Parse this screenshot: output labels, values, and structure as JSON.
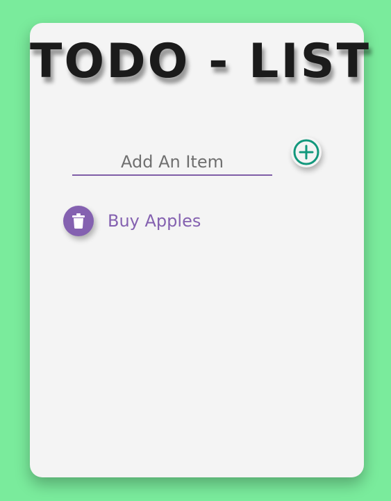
{
  "app": {
    "title": "TODO - LIST"
  },
  "input": {
    "placeholder": "Add An Item",
    "value": ""
  },
  "add_button": {
    "icon": "plus-circle-icon"
  },
  "items": [
    {
      "label": "Buy Apples",
      "icon": "trash-icon"
    }
  ],
  "colors": {
    "background": "#7aeb9c",
    "card": "#f4f4f4",
    "accent_purple": "#8461b0",
    "accent_teal": "#12977c"
  }
}
